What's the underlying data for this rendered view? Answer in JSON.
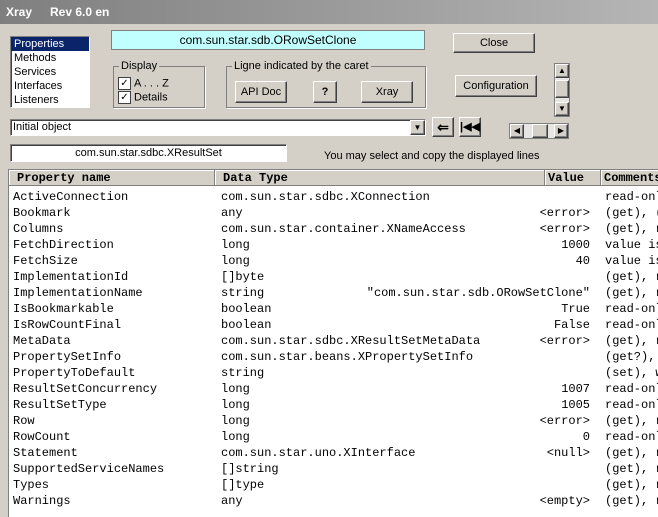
{
  "window": {
    "app": "Xray",
    "rev": "Rev 6.0 en"
  },
  "object_name": "com.sun.star.sdb.ORowSetClone",
  "categories": [
    "Properties",
    "Methods",
    "Services",
    "Interfaces",
    "Listeners"
  ],
  "selected_category": "Properties",
  "buttons": {
    "close": "Close",
    "configuration": "Configuration",
    "api_doc": "API Doc",
    "help": "?",
    "xray": "Xray"
  },
  "display": {
    "title": "Display",
    "sort_label": "A . . . Z",
    "details_label": "Details",
    "sort_checked": true,
    "details_checked": true
  },
  "caret_group": {
    "title": "Ligne indicated by the caret"
  },
  "history": {
    "value": "Initial object"
  },
  "type_field": "com.sun.star.sdbc.XResultSet",
  "hint": "You may select and copy the displayed lines",
  "table": {
    "headers": [
      "Property name",
      "Data Type",
      "Value",
      "Comments"
    ],
    "rows": [
      [
        "ActiveConnection",
        "com.sun.star.sdbc.XConnection",
        "",
        "read-only"
      ],
      [
        "Bookmark",
        "any",
        "<error>",
        "(get), (set)"
      ],
      [
        "Columns",
        "com.sun.star.container.XNameAccess",
        "<error>",
        "(get), read-only"
      ],
      [
        "FetchDirection",
        "long",
        "1000",
        "value is ..."
      ],
      [
        "FetchSize",
        "long",
        "40",
        "value is ..."
      ],
      [
        "ImplementationId",
        "[]byte",
        "",
        "(get), read-only"
      ],
      [
        "ImplementationName",
        "string",
        "\"com.sun.star.sdb.ORowSetClone\"",
        "(get), read-only"
      ],
      [
        "IsBookmarkable",
        "boolean",
        "True",
        "read-only"
      ],
      [
        "IsRowCountFinal",
        "boolean",
        "False",
        "read-only"
      ],
      [
        "MetaData",
        "com.sun.star.sdbc.XResultSetMetaData",
        "<error>",
        "(get), read-only"
      ],
      [
        "PropertySetInfo",
        "com.sun.star.beans.XPropertySetInfo",
        "",
        "(get?), read-only"
      ],
      [
        "PropertyToDefault",
        "string",
        "",
        "(set), write-only"
      ],
      [
        "ResultSetConcurrency",
        "long",
        "1007",
        "read-only"
      ],
      [
        "ResultSetType",
        "long",
        "1005",
        "read-only"
      ],
      [
        "Row",
        "long",
        "<error>",
        "(get), read-only"
      ],
      [
        "RowCount",
        "long",
        "0",
        "read-only"
      ],
      [
        "Statement",
        "com.sun.star.uno.XInterface",
        "<null>",
        "(get), read-only"
      ],
      [
        "SupportedServiceNames",
        "[]string",
        "",
        "(get), read-only"
      ],
      [
        "Types",
        "[]type",
        "",
        "(get), read-only"
      ],
      [
        "Warnings",
        "any",
        "<empty>",
        "(get), read-only"
      ]
    ]
  },
  "icons": {
    "back": "arrow-left-icon",
    "first": "first-record-icon",
    "dropdown": "chevron-down-icon",
    "scroll_up": "triangle-up-icon",
    "scroll_down": "triangle-down-icon",
    "h_left": "triangle-left-icon",
    "h_right": "triangle-right-icon"
  },
  "colors": {
    "selection": "#0a246a",
    "object_name_bg": "#c0fffe",
    "window_bg": "#d4d0c8"
  }
}
